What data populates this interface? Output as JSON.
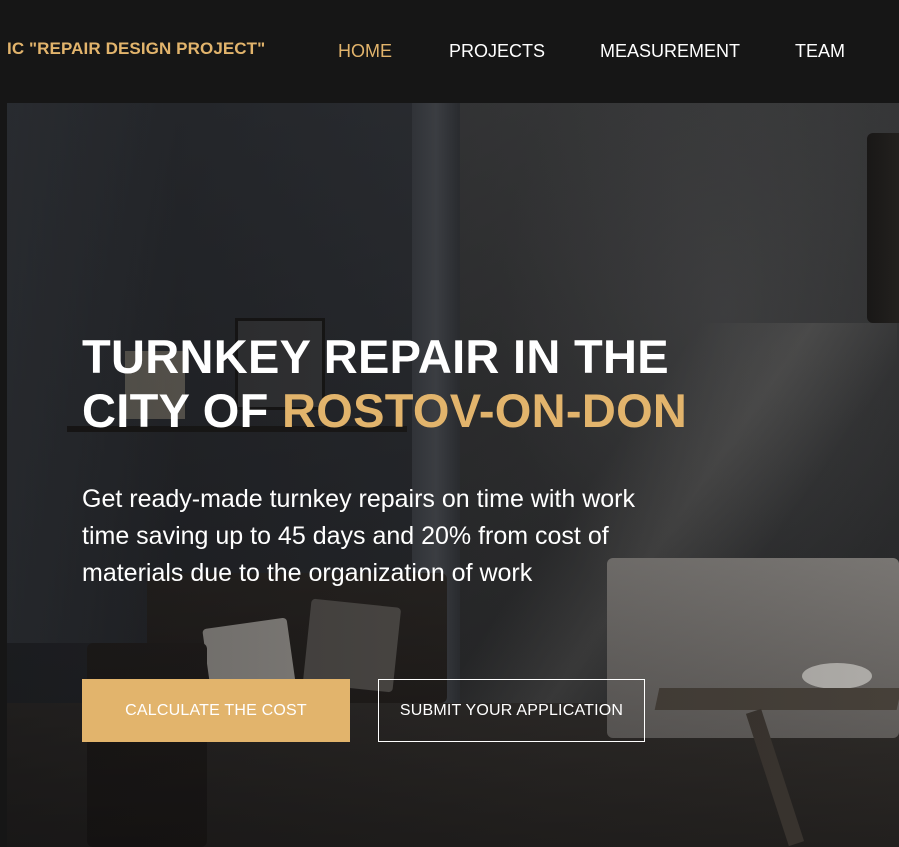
{
  "header": {
    "logo": "IC \"REPAIR DESIGN PROJECT\"",
    "nav": [
      {
        "label": "HOME",
        "active": true
      },
      {
        "label": "PROJECTS",
        "active": false
      },
      {
        "label": "MEASUREMENT",
        "active": false
      },
      {
        "label": "TEAM",
        "active": false
      }
    ]
  },
  "hero": {
    "title_line1": "TURNKEY REPAIR IN THE",
    "title_line2_prefix": "CITY OF ",
    "title_line2_accent": "ROSTOV-ON-DON",
    "description": "Get ready-made turnkey repairs on time with work time saving up to 45 days and 20% from cost of materials due to the organization of work",
    "primary_button": "CALCULATE THE COST",
    "secondary_button": "SUBMIT YOUR APPLICATION"
  },
  "colors": {
    "accent": "#e2b46c",
    "header_bg": "#161616",
    "text": "#ffffff"
  }
}
